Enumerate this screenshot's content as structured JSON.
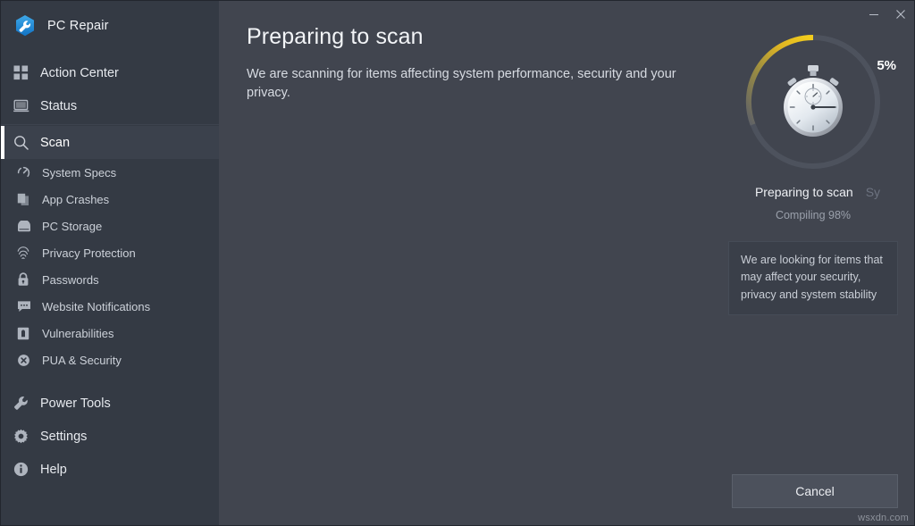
{
  "window": {
    "app_name": "PC Repair",
    "logo_icon": "wrench-hexagon-icon",
    "controls": {
      "minimize_label": "Minimize",
      "minimize_icon": "minimize-icon",
      "close_label": "Close",
      "close_icon": "close-icon"
    },
    "watermark": "wsxdn.com"
  },
  "colors": {
    "sidebar_bg": "#343a44",
    "content_bg": "#41454f",
    "accent_progress": "#e8c11f",
    "ring_track": "#4a4f5a",
    "active_indicator": "#ffffff",
    "text_primary": "#f2f4f7",
    "text_secondary": "#d7dbe2",
    "text_muted": "#9aa0ab"
  },
  "sidebar": {
    "primary_items": [
      {
        "label": "Action Center",
        "icon": "grid-squares-icon",
        "active": false
      },
      {
        "label": "Status",
        "icon": "monitor-icon",
        "active": false
      },
      {
        "label": "Scan",
        "icon": "search-icon",
        "active": true
      }
    ],
    "sub_items": [
      {
        "label": "System Specs",
        "icon": "gauge-icon"
      },
      {
        "label": "App Crashes",
        "icon": "copy-pages-icon"
      },
      {
        "label": "PC Storage",
        "icon": "hard-drive-icon"
      },
      {
        "label": "Privacy Protection",
        "icon": "fingerprint-icon"
      },
      {
        "label": "Passwords",
        "icon": "lock-icon"
      },
      {
        "label": "Website Notifications",
        "icon": "chat-bubble-icon"
      },
      {
        "label": "Vulnerabilities",
        "icon": "shield-alert-icon"
      },
      {
        "label": "PUA & Security",
        "icon": "virus-circle-icon"
      }
    ],
    "bottom_items": [
      {
        "label": "Power Tools",
        "icon": "wrench-icon"
      },
      {
        "label": "Settings",
        "icon": "gear-icon"
      },
      {
        "label": "Help",
        "icon": "info-circle-icon"
      }
    ]
  },
  "main": {
    "title": "Preparing to scan",
    "description": "We are scanning for items affecting system performance, security and your privacy.",
    "cancel_label": "Cancel"
  },
  "progress": {
    "percent_label": "5%",
    "percent_value": 5,
    "ring_icon": "stopwatch-icon",
    "current_step": "Preparing to scan",
    "next_step": "Sy",
    "sub_status": "Compiling 98%",
    "tip": "We are looking for items that may affect your security, privacy and system stability"
  }
}
